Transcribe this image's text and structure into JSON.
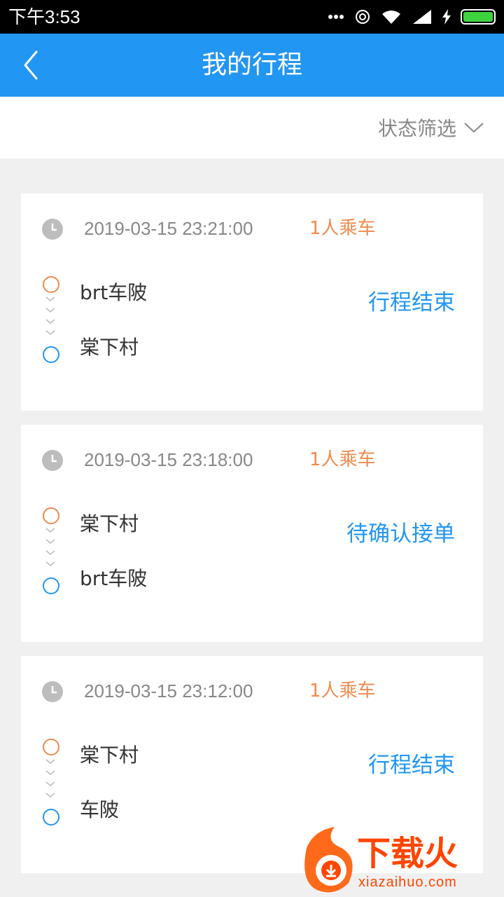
{
  "status_bar": {
    "time": "下午3:53"
  },
  "header": {
    "title": "我的行程"
  },
  "filter": {
    "label": "状态筛选"
  },
  "trips": [
    {
      "datetime": "2019-03-15 23:21:00",
      "passengers": "1人乘车",
      "from": "brt车陂",
      "to": "棠下村",
      "status": "行程结束"
    },
    {
      "datetime": "2019-03-15 23:18:00",
      "passengers": "1人乘车",
      "from": "棠下村",
      "to": "brt车陂",
      "status": "待确认接单"
    },
    {
      "datetime": "2019-03-15 23:12:00",
      "passengers": "1人乘车",
      "from": "棠下村",
      "to": "车陂",
      "status": "行程结束"
    }
  ],
  "watermark": {
    "brand": "下载火",
    "url": "xiazaihuo.com"
  },
  "colors": {
    "primary": "#2196f3",
    "accent": "#f08a4b"
  }
}
